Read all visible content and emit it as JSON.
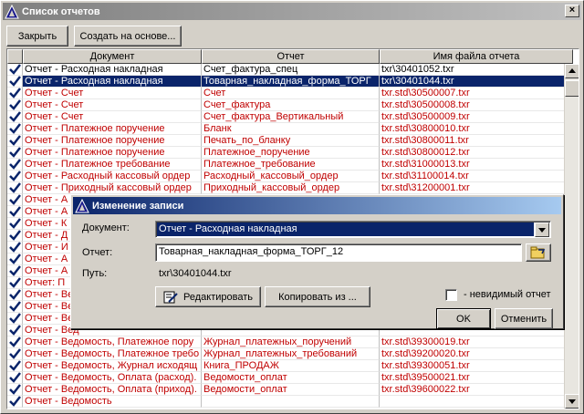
{
  "window": {
    "title": "Список отчетов"
  },
  "toolbar": {
    "close_label": "Закрыть",
    "create_label": "Создать на основе..."
  },
  "grid": {
    "columns": [
      "Документ",
      "Отчет",
      "Имя файла отчета"
    ],
    "rows": [
      {
        "doc": "Отчет - Расходная накладная",
        "report": "Счет_фактура_спец",
        "file": "txr\\30401052.txr"
      },
      {
        "doc": "Отчет - Расходная накладная",
        "report": "Товарная_накладная_форма_ТОРГ",
        "file": "txr\\30401044.txr"
      },
      {
        "doc": "Отчет - Счет",
        "report": "Счет",
        "file": "txr.std\\30500007.txr"
      },
      {
        "doc": "Отчет - Счет",
        "report": "Счет_фактура",
        "file": "txr.std\\30500008.txr"
      },
      {
        "doc": "Отчет - Счет",
        "report": "Счет_фактура_Вертикальный",
        "file": "txr.std\\30500009.txr"
      },
      {
        "doc": "Отчет - Платежное поручение",
        "report": "Бланк",
        "file": "txr.std\\30800010.txr"
      },
      {
        "doc": "Отчет - Платежное поручение",
        "report": "Печать_по_бланку",
        "file": "txr.std\\30800011.txr"
      },
      {
        "doc": "Отчет - Платежное поручение",
        "report": "Платежное_поручение",
        "file": "txr.std\\30800012.txr"
      },
      {
        "doc": "Отчет - Платежное требование",
        "report": "Платежное_требование",
        "file": "txr.std\\31000013.txr"
      },
      {
        "doc": "Отчет - Расходный кассовый ордер",
        "report": "Расходный_кассовый_ордер",
        "file": "txr.std\\31100014.txr"
      },
      {
        "doc": "Отчет - Приходный кассовый ордер",
        "report": "Приходный_кассовый_ордер",
        "file": "txr.std\\31200001.txr"
      },
      {
        "doc": "Отчет - А",
        "report": "",
        "file": ""
      },
      {
        "doc": "Отчет - А",
        "report": "",
        "file": ""
      },
      {
        "doc": "Отчет - К",
        "report": "",
        "file": ""
      },
      {
        "doc": "Отчет - Д",
        "report": "",
        "file": ""
      },
      {
        "doc": "Отчет - И",
        "report": "",
        "file": ""
      },
      {
        "doc": "Отчет - А",
        "report": "",
        "file": ""
      },
      {
        "doc": "Отчет - А",
        "report": "",
        "file": ""
      },
      {
        "doc": "Отчет: П",
        "report": "",
        "file": ""
      },
      {
        "doc": "Отчет - Вед",
        "report": "",
        "file": ""
      },
      {
        "doc": "Отчет - Вед",
        "report": "",
        "file": ""
      },
      {
        "doc": "Отчет - Вед",
        "report": "",
        "file": ""
      },
      {
        "doc": "Отчет - Вед",
        "report": "",
        "file": ""
      },
      {
        "doc": "Отчет - Ведомость, Платежное пору",
        "report": "Журнал_платежных_поручений",
        "file": "txr.std\\39300019.txr"
      },
      {
        "doc": "Отчет - Ведомость, Платежное требо",
        "report": "Журнал_платежных_требований",
        "file": "txr.std\\39200020.txr"
      },
      {
        "doc": "Отчет - Ведомость, Журнал исходящ",
        "report": "Книга_ПРОДАЖ",
        "file": "txr.std\\39300051.txr"
      },
      {
        "doc": "Отчет - Ведомость, Оплата (расход).",
        "report": "Ведомости_оплат",
        "file": "txr.std\\39500021.txr"
      },
      {
        "doc": "Отчет - Ведомость, Оплата (приход).",
        "report": "Ведомости_оплат",
        "file": "txr.std\\39600022.txr"
      },
      {
        "doc": "Отчет - Ведомость",
        "report": "",
        "file": ""
      }
    ]
  },
  "dialog": {
    "title": "Изменение записи",
    "document_label": "Документ:",
    "document_value": "Отчет - Расходная накладная",
    "report_label": "Отчет:",
    "report_value": "Товарная_накладная_форма_ТОРГ_12",
    "path_label": "Путь:",
    "path_value": "txr\\30401044.txr",
    "edit_label": "Редактировать",
    "copy_label": "Копировать из ...",
    "invisible_label": "- невидимый отчет",
    "ok_label": "OK",
    "cancel_label": "Отменить"
  },
  "colors": {
    "title_active": "#0a246a",
    "row_text": "#c00000",
    "selection": "#0a246a"
  }
}
